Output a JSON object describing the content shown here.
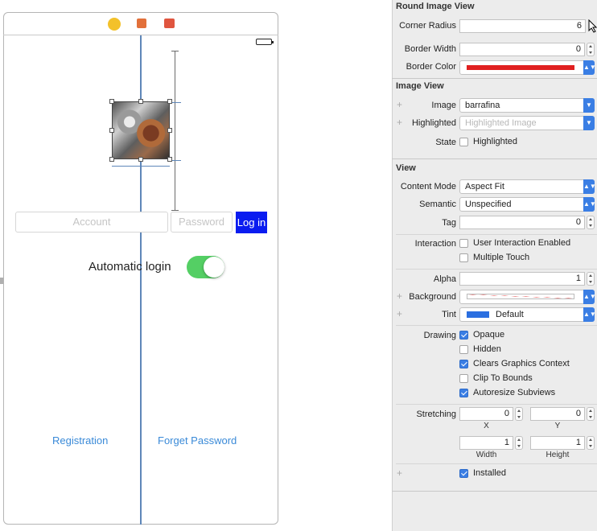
{
  "canvas": {
    "text_fields": {
      "account_placeholder": "Account",
      "password_placeholder": "Password"
    },
    "login_button_label": "Log in",
    "auto_login_label": "Automatic login",
    "auto_login_on": true,
    "registration_link": "Registration",
    "forget_password_link": "Forget Password",
    "image_name": "barrafina"
  },
  "inspector": {
    "round_image_view": {
      "title": "Round Image View",
      "corner_radius_label": "Corner Radius",
      "corner_radius": "6",
      "border_width_label": "Border Width",
      "border_width": "0",
      "border_color_label": "Border Color",
      "border_color": "#e02020"
    },
    "image_view": {
      "title": "Image View",
      "image_label": "Image",
      "image_value": "barrafina",
      "highlighted_label": "Highlighted",
      "highlighted_placeholder": "Highlighted Image",
      "state_label": "State",
      "state_checkbox_label": "Highlighted"
    },
    "view": {
      "title": "View",
      "content_mode_label": "Content Mode",
      "content_mode": "Aspect Fit",
      "semantic_label": "Semantic",
      "semantic": "Unspecified",
      "tag_label": "Tag",
      "tag": "0",
      "interaction_label": "Interaction",
      "user_interaction": "User Interaction Enabled",
      "multiple_touch": "Multiple Touch",
      "alpha_label": "Alpha",
      "alpha": "1",
      "background_label": "Background",
      "tint_label": "Tint",
      "tint_value": "Default",
      "tint_color": "#2b6fe0",
      "drawing_label": "Drawing",
      "drawing": [
        {
          "label": "Opaque",
          "checked": true
        },
        {
          "label": "Hidden",
          "checked": false
        },
        {
          "label": "Clears Graphics Context",
          "checked": true
        },
        {
          "label": "Clip To Bounds",
          "checked": false
        },
        {
          "label": "Autoresize Subviews",
          "checked": true
        }
      ],
      "stretching_label": "Stretching",
      "stretch_x": "0",
      "stretch_y": "0",
      "stretch_width": "1",
      "stretch_height": "1",
      "x_caption": "X",
      "y_caption": "Y",
      "width_caption": "Width",
      "height_caption": "Height",
      "installed_label": "Installed"
    }
  },
  "toolbar_icons": [
    "view-controller-icon",
    "first-responder-icon",
    "exit-icon"
  ]
}
